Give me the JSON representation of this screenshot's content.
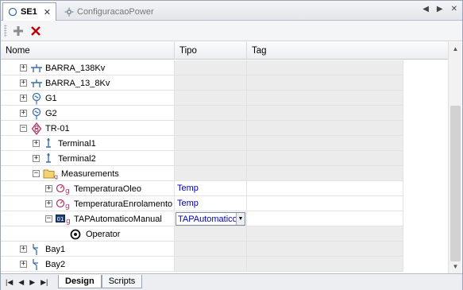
{
  "tabs": [
    {
      "label": "SE1",
      "close": "✕"
    },
    {
      "label": "ConfiguracaoPower"
    }
  ],
  "grid": {
    "columns": [
      "Nome",
      "Tipo",
      "Tag"
    ],
    "rows": [
      {
        "name": "BARRA_138Kv",
        "expander": "+",
        "tipo": ""
      },
      {
        "name": "BARRA_13_8Kv",
        "expander": "+",
        "tipo": ""
      },
      {
        "name": "G1",
        "expander": "+",
        "tipo": ""
      },
      {
        "name": "G2",
        "expander": "+",
        "tipo": ""
      },
      {
        "name": "TR-01",
        "expander": "−",
        "tipo": ""
      },
      {
        "name": "Terminal1",
        "expander": "+",
        "tipo": ""
      },
      {
        "name": "Terminal2",
        "expander": "+",
        "tipo": ""
      },
      {
        "name": "Measurements",
        "expander": "−",
        "tipo": ""
      },
      {
        "name": "TemperaturaOleo",
        "expander": "+",
        "tipo": "Temp"
      },
      {
        "name": "TemperaturaEnrolamento",
        "expander": "+",
        "tipo": "Temp"
      },
      {
        "name": "TAPAutomaticoManual",
        "expander": "−",
        "tipo": "TAPAutomatico"
      },
      {
        "name": "Operator",
        "expander": "",
        "tipo": ""
      },
      {
        "name": "Bay1",
        "expander": "+",
        "tipo": ""
      },
      {
        "name": "Bay2",
        "expander": "+",
        "tipo": ""
      }
    ]
  },
  "bottom_tabs": [
    "Design",
    "Scripts"
  ],
  "colors": {
    "accent": "#0000c0",
    "delete": "#c00000"
  }
}
